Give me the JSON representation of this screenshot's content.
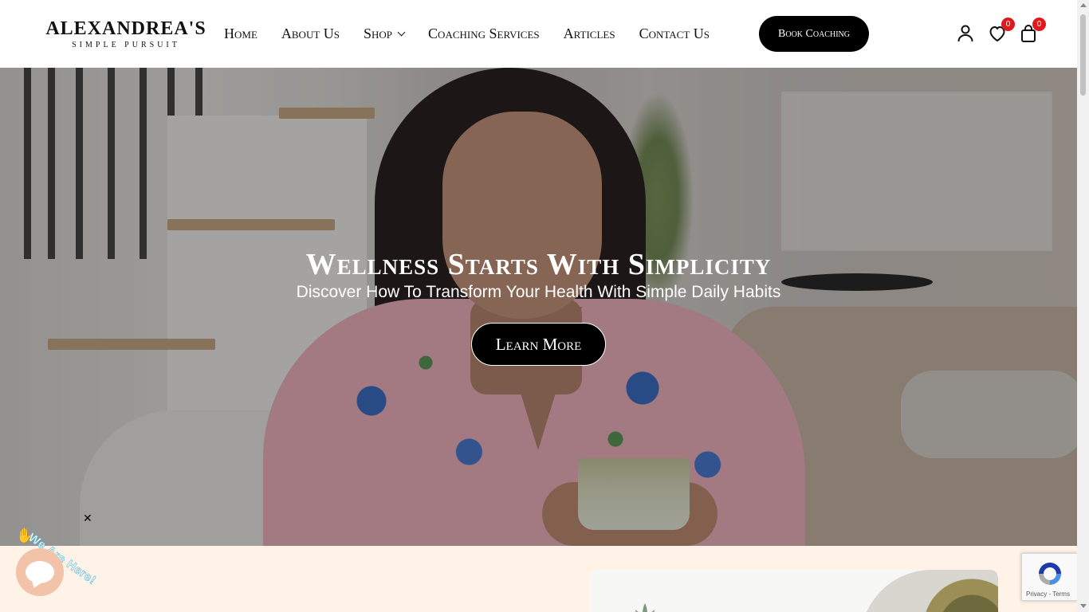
{
  "brand": {
    "name": "ALEXANDREA'S",
    "tagline": "Simple Pursuit"
  },
  "nav": {
    "items": [
      {
        "label": "Home"
      },
      {
        "label": "About Us"
      },
      {
        "label": "Shop"
      },
      {
        "label": "Coaching Services"
      },
      {
        "label": "Articles"
      },
      {
        "label": "Contact Us"
      }
    ],
    "cta": "Book Coaching"
  },
  "header_icons": {
    "account": "user-icon",
    "wishlist": "heart-icon",
    "wishlist_count": "0",
    "cart": "shopping-bag-icon",
    "cart_count": "0"
  },
  "hero": {
    "title": "Wellness Starts With Simplicity",
    "subtitle": "Discover How To Transform Your Health With Simple Daily Habits",
    "button": "Learn More"
  },
  "chat_widget": {
    "label": "We Are Here!",
    "close": "✕"
  },
  "recaptcha": {
    "text": "Privacy - Terms"
  },
  "colors": {
    "accent": "#000000",
    "badge": "#e0191c",
    "band": "#fff3e8",
    "chat": "#f3c3a9"
  }
}
